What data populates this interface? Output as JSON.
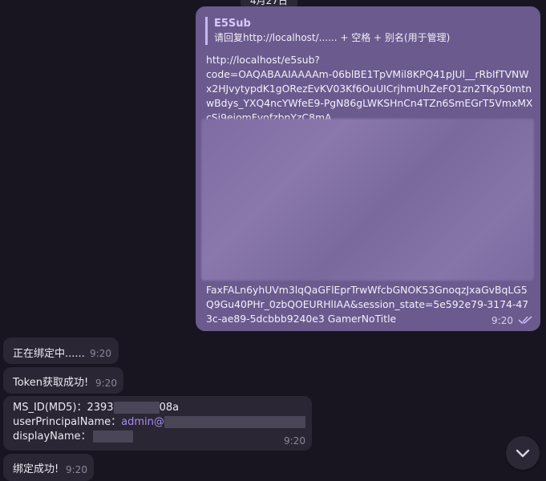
{
  "date_label": "4月27日",
  "outgoing": {
    "reply": {
      "sender": "E5Sub",
      "text": "请回复http://localhost/...... + 空格 + 别名(用于管理)"
    },
    "url_head": "http://localhost/e5sub?\ncode=OAQABAAIAAAAm-06blBE1TpVMil8KPQ41pJUl__rRbIfTVNWx2HJvytypdK1gORezEvKV03Kf6OuUICrjhmUhZeFO1zn2TKp50mtnwBdys_YXQ4ncYWfeE9-PgN86gLWKSHnCn4TZn6SmEGrT5VmxMXcSi9eiomFvofzbnYzC8mA",
    "url_tail": "FaxFALn6yhUVm3lqQaGFlEprTrwWfcbGNOK53GnoqzJxaGvBqLG5Q9Gu40PHr_0zbQOEURHlIAA&session_state=5e592e79-3174-473c-ae89-5dcbbb9240e3 GamerNoTitle",
    "time": "9:20"
  },
  "incoming": [
    {
      "text": "正在绑定中......",
      "time": "9:20"
    },
    {
      "text": "Token获取成功!",
      "time": "9:20"
    },
    {
      "ms_id_label": "MS_ID(MD5)：",
      "ms_id_prefix": "2393",
      "ms_id_suffix": "08a",
      "upn_label": "userPrincipalName：",
      "upn_value": "admin@",
      "display_label": "displayName：",
      "time": "9:20"
    },
    {
      "text": "绑定成功!",
      "time": "9:20"
    }
  ],
  "colors": {
    "background": "#181520",
    "outgoing_bubble": "#6a5a8e",
    "incoming_bubble": "#2a2634",
    "accent": "#a88df2"
  }
}
